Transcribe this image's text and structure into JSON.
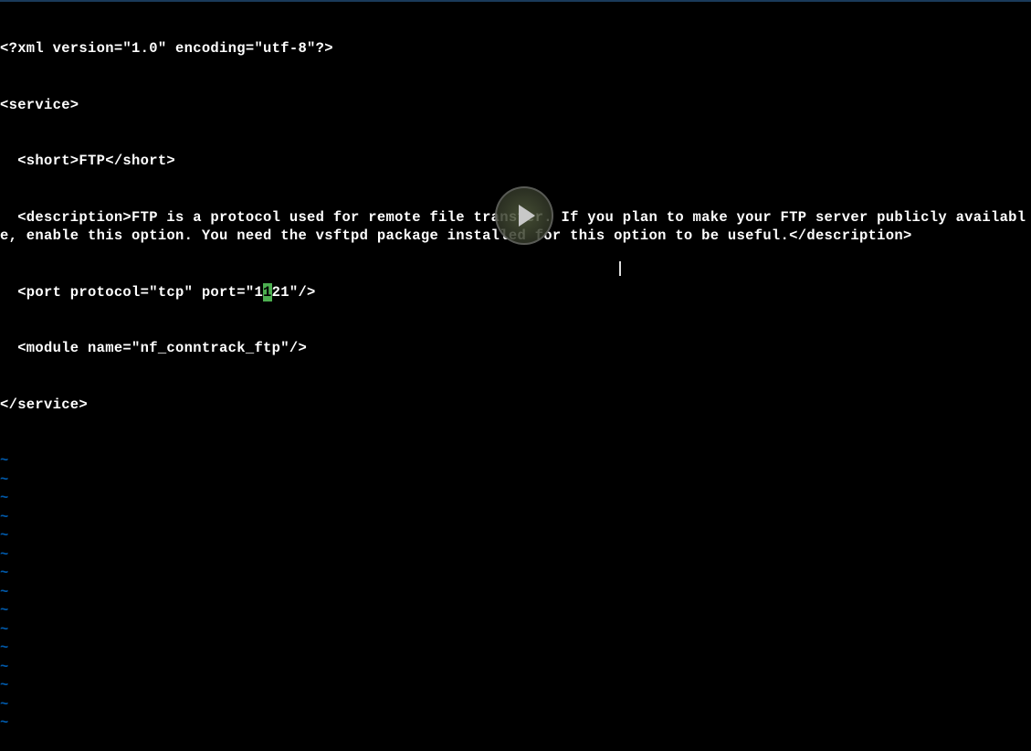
{
  "editor": {
    "lines": [
      "<?xml version=\"1.0\" encoding=\"utf-8\"?>",
      "<service>",
      "  <short>FTP</short>",
      "  <description>FTP is a protocol used for remote file transfer. If you plan to make your FTP server publicly available, enable this option. You need the vsftpd package installed for this option to be useful.</description>",
      "  <port protocol=\"tcp\" port=\"1121\"/>",
      "  <module name=\"nf_conntrack_ftp\"/>",
      "</service>"
    ],
    "cursor": {
      "line_index": 4,
      "char_index": 30,
      "char": "1"
    },
    "empty_line_marker": "~",
    "empty_line_count": 15
  },
  "overlay": {
    "play_button": true
  }
}
